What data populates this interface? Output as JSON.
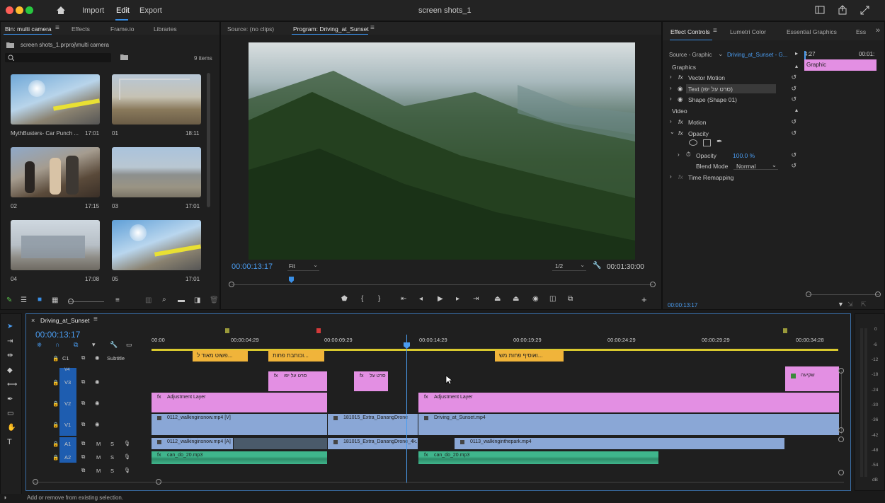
{
  "app": {
    "window_title": "screen shots_1",
    "nav": [
      "Import",
      "Edit",
      "Export"
    ]
  },
  "project": {
    "tabs": [
      "Bin: multi camera",
      "Effects",
      "Frame.io",
      "Libraries"
    ],
    "path": "screen shots_1.prproj\\multi camera",
    "item_count": "9 items",
    "clips": [
      {
        "name": "MythBusters- Car Punch ...",
        "duration": "17:01"
      },
      {
        "name": "01",
        "duration": "18:11"
      },
      {
        "name": "02",
        "duration": "17:15"
      },
      {
        "name": "03",
        "duration": "17:01"
      },
      {
        "name": "04",
        "duration": "17:08"
      },
      {
        "name": "05",
        "duration": "17:01"
      }
    ]
  },
  "monitor": {
    "source_tab": "Source: (no clips)",
    "program_tab": "Program: Driving_at_Sunset",
    "current_time": "00:00:13:17",
    "fit": "Fit",
    "resolution": "1/2",
    "duration": "00:01:30:00"
  },
  "effect_controls": {
    "tabs": [
      "Effect Controls",
      "Lumetri Color",
      "Essential Graphics",
      "Ess"
    ],
    "source_label": "Source - Graphic",
    "sequence_label": "Driving_at_Sunset - G...",
    "time_start": "4:27",
    "time_end": "00:01:",
    "graphic_bar": "Graphic",
    "section_graphics": "Graphics",
    "vector_motion": "Vector Motion",
    "text_layer": "Text (סרט על יפו)",
    "shape_layer": "Shape (Shape 01)",
    "section_video": "Video",
    "motion": "Motion",
    "opacity": "Opacity",
    "opacity_prop": "Opacity",
    "opacity_value": "100.0 %",
    "blend_mode_label": "Blend Mode",
    "blend_mode_value": "Normal",
    "time_remapping": "Time Remapping",
    "footer_time": "00:00:13:17"
  },
  "timeline": {
    "sequence_name": "Driving_at_Sunset",
    "current_time": "00:00:13:17",
    "ruler": [
      "00:00",
      "00:00:04:29",
      "00:00:09:29",
      "00:00:14:29",
      "00:00:19:29",
      "00:00:24:29",
      "00:00:29:29",
      "00:00:34:28"
    ],
    "tracks": {
      "c1": "C1",
      "subtitle": "Subtitle",
      "v4": "V4",
      "v3": "V3",
      "v2": "V2",
      "v1": "V1",
      "a1": "A1",
      "a2": "A2",
      "m": "M",
      "s": "S"
    },
    "captions": [
      {
        "text": "פשוט מאוד ל..."
      },
      {
        "text": "וכותבת פחות..."
      },
      {
        "text": "ואוסיף פחות מש..."
      }
    ],
    "v3_clips": [
      "סרט על יפו",
      "סרט על",
      "שקיעה"
    ],
    "v2_clips": [
      "Adjustment Layer",
      "Adjustment Layer"
    ],
    "v1_clips": [
      "0112_walkinginsnow.mp4 [V]",
      "181015_Extra_DanangDrone",
      "Driving_at_Sunset.mp4"
    ],
    "a1_clips": [
      "0112_walkinginsnow.mp4 [A]",
      "181015_Extra_DanangDrone_4k.",
      "0113_walkinginthepark.mp4"
    ],
    "a2_clips": [
      "can_do_20.mp3",
      "can_do_20.mp3"
    ],
    "vu_scale": [
      "0",
      "-6",
      "-12",
      "-18",
      "-24",
      "-30",
      "-36",
      "-42",
      "-48",
      "-54",
      "dB"
    ]
  },
  "status": {
    "text": "Add or remove from existing selection."
  },
  "colors": {
    "accent_blue": "#3a8fe6",
    "clip_pink": "#e38fe3",
    "clip_blue": "#8aa7d6",
    "clip_green": "#3fb58c",
    "caption_orange": "#f0b43a",
    "playhead": "#4a9cf0"
  }
}
